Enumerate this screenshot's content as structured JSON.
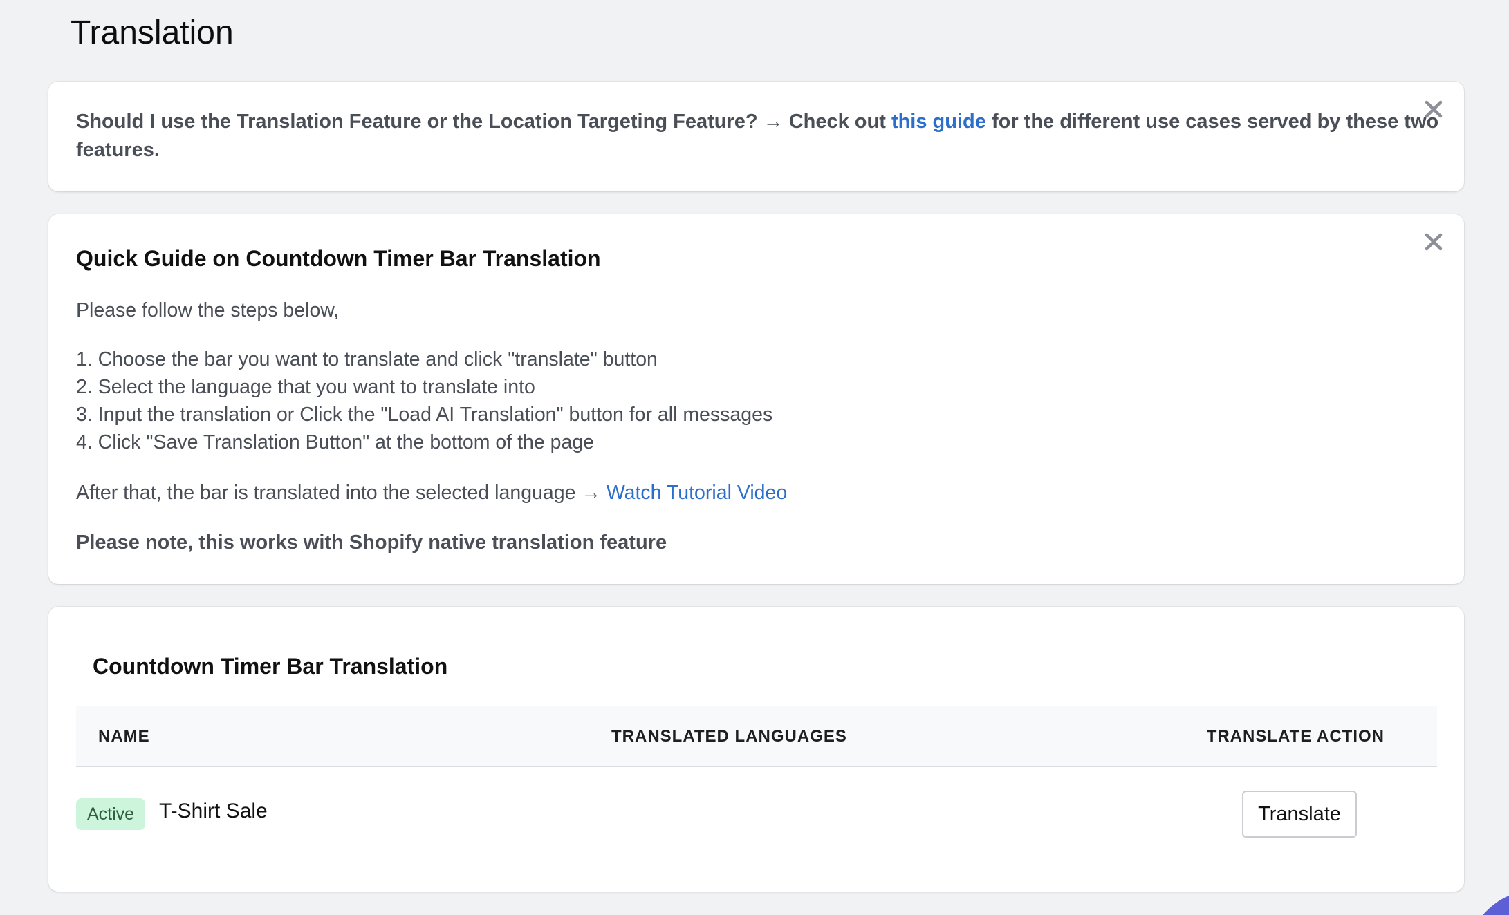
{
  "page": {
    "title": "Translation"
  },
  "notice": {
    "text_before": "Should I use the Translation Feature or the Location Targeting Feature? → Check out ",
    "link_label": "this guide",
    "text_after": " for the different use cases served by these two features.",
    "close_icon": "close-icon"
  },
  "guide": {
    "title": "Quick Guide on Countdown Timer Bar Translation",
    "intro": "Please follow the steps below,",
    "steps": [
      "1. Choose the bar you want to translate and click \"translate\" button",
      "2. Select the language that you want to translate into",
      "3. Input the translation or Click the \"Load AI Translation\" button for all messages",
      "4. Click \"Save Translation Button\" at the bottom of the page"
    ],
    "after_text": "After that, the bar is translated into the selected language → ",
    "video_link_label": "Watch Tutorial Video",
    "note": "Please note, this works with Shopify native translation feature",
    "close_icon": "close-icon"
  },
  "table": {
    "title": "Countdown Timer Bar Translation",
    "columns": [
      "NAME",
      "TRANSLATED LANGUAGES",
      "TRANSLATE ACTION"
    ],
    "rows": [
      {
        "status": "Active",
        "name": "T-Shirt Sale",
        "languages": "",
        "action_label": "Translate"
      }
    ]
  },
  "colors": {
    "background": "#f1f2f4",
    "card": "#ffffff",
    "link": "#2c6ecb",
    "badge_bg": "#cdf5dc",
    "badge_text": "#2f5e43",
    "corner_accent": "#5c5fd6"
  }
}
